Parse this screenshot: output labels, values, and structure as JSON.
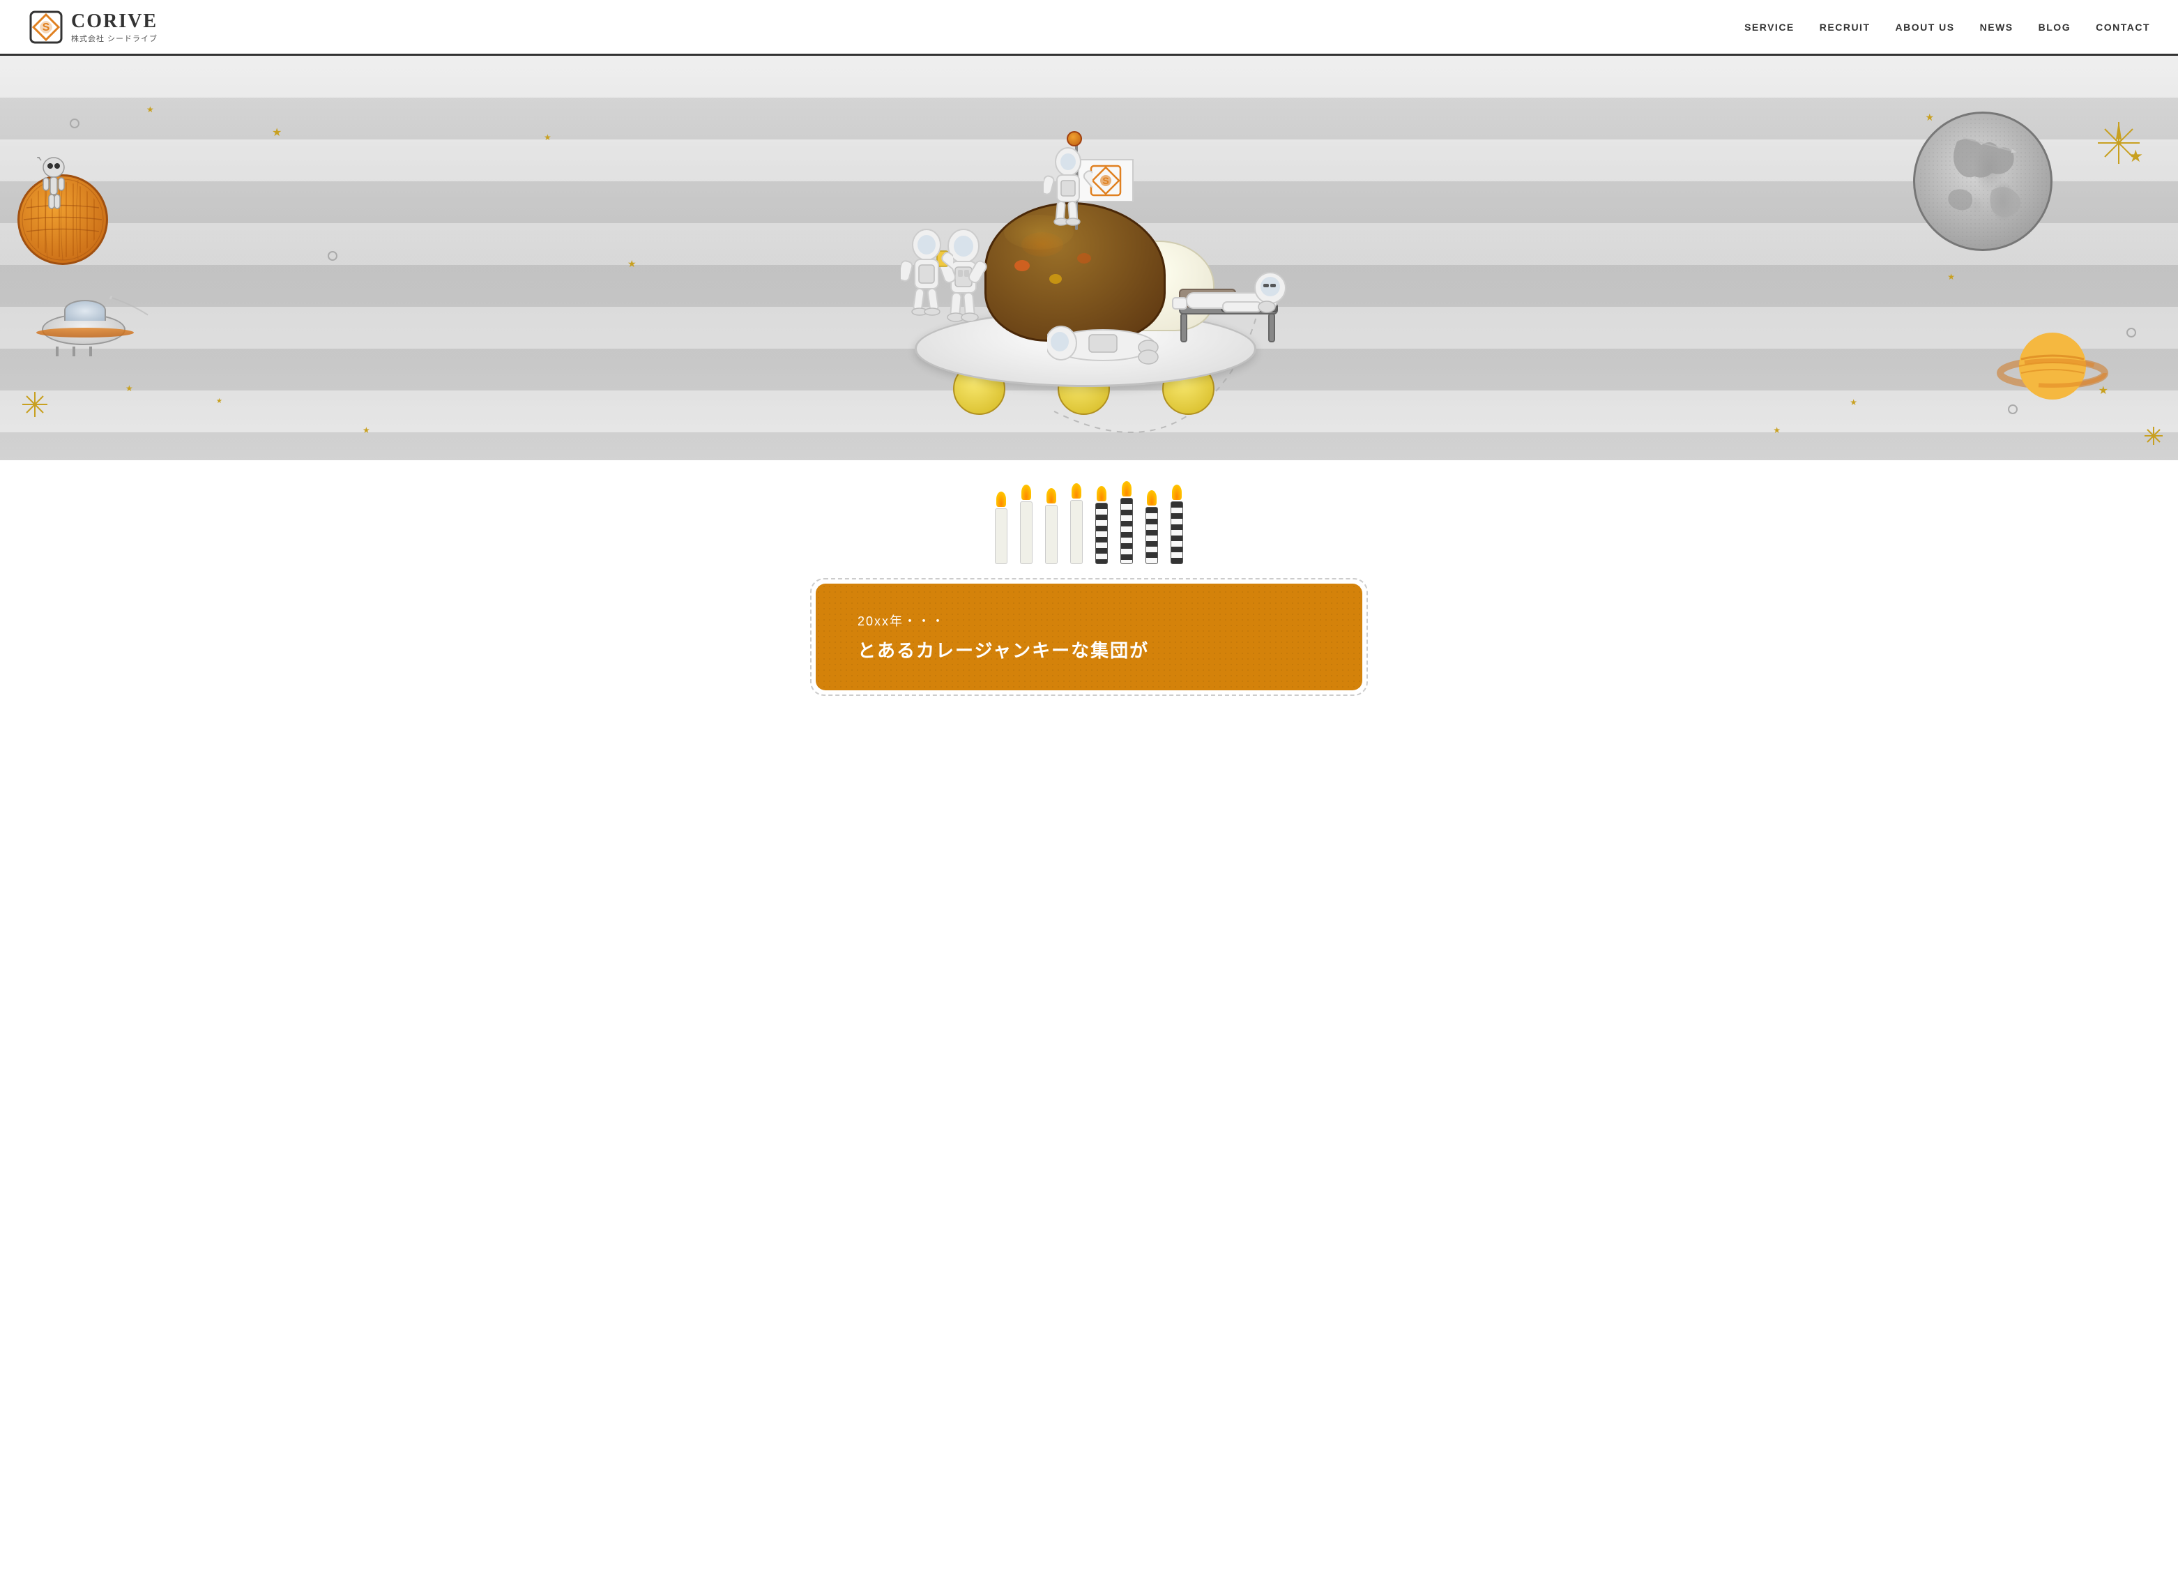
{
  "header": {
    "logo_title": "CORIVE",
    "logo_subtitle": "株式会社 シードライブ",
    "nav": {
      "service": "SERVICE",
      "recruit": "RECRUIT",
      "about_us": "ABOUT US",
      "news": "NEWS",
      "blog": "BLOG",
      "contact": "CONTACT"
    }
  },
  "hero": {
    "alt": "Space curry illustration with astronauts"
  },
  "candles": {
    "count": 8,
    "mixed": "4 plain, 4 striped"
  },
  "orange_box": {
    "text1": "20xx年・・・",
    "text2": "とあるカレージャンキーな集団が"
  },
  "icons": {
    "logo_diamond": "◆",
    "star": "★",
    "sparkle": "✦"
  },
  "colors": {
    "accent": "#e08020",
    "dark": "#333333",
    "nav_text": "#333333",
    "orange_box": "#d4820a",
    "candle_flame": "#ff8800"
  }
}
